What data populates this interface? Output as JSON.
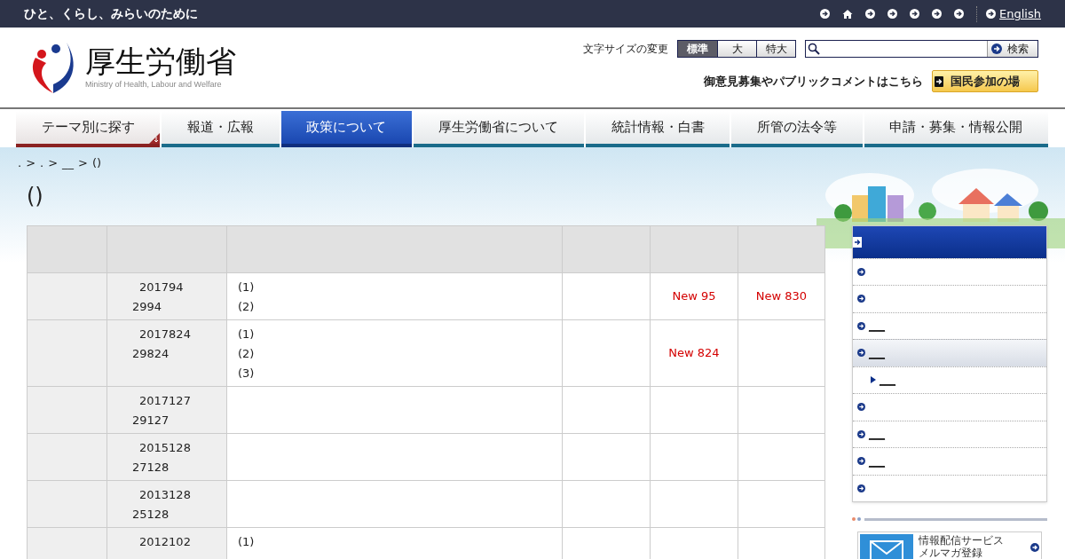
{
  "top_bar": {
    "tagline": "ひと、くらし、みらいのために",
    "links": [
      {
        "kind": "arrow"
      },
      {
        "kind": "home"
      },
      {
        "kind": "arrow"
      },
      {
        "kind": "arrow"
      },
      {
        "kind": "arrow"
      },
      {
        "kind": "arrow"
      },
      {
        "kind": "arrow"
      }
    ],
    "language_link": "English"
  },
  "header": {
    "logo_title": "厚生労働省",
    "logo_subtitle": "Ministry of Health, Labour and Welfare",
    "font_size_label": "文字サイズの変更",
    "font_sizes": [
      {
        "label": "標準",
        "selected": true
      },
      {
        "label": "大",
        "selected": false
      },
      {
        "label": "特大",
        "selected": false
      }
    ],
    "search_button": "検索",
    "comment_text": "御意見募集やパブリックコメントはこちら",
    "participation_button": "国民参加の場"
  },
  "nav": [
    {
      "label": "テーマ別に探す",
      "selected": false,
      "kind": "theme"
    },
    {
      "label": "報道・広報",
      "selected": false,
      "kind": "plain"
    },
    {
      "label": "政策について",
      "selected": true,
      "kind": "plain"
    },
    {
      "label": "厚生労働省について",
      "selected": false,
      "kind": "plain"
    },
    {
      "label": "統計情報・白書",
      "selected": false,
      "kind": "plain"
    },
    {
      "label": "所管の法令等",
      "selected": false,
      "kind": "plain"
    },
    {
      "label": "申請・募集・情報公開",
      "selected": false,
      "kind": "plain"
    }
  ],
  "breadcrumb": [
    ".",
    ">",
    ".",
    ">",
    "__",
    ">",
    "()"
  ],
  "page_title": "()",
  "table": {
    "rows": [
      {
        "date": [
          "201794",
          "2994"
        ],
        "items": [
          "(1)",
          "(2)"
        ],
        "column_5": "New 95",
        "column_6": "New 830"
      },
      {
        "date": [
          "2017824",
          "29824"
        ],
        "items": [
          "(1)",
          "(2)",
          "(3)"
        ],
        "column_5": "New 824"
      },
      {
        "date": [
          "2017127",
          "29127"
        ],
        "items": []
      },
      {
        "date": [
          "2015128",
          "27128"
        ],
        "items": []
      },
      {
        "date": [
          "2013128",
          "25128"
        ],
        "items": []
      },
      {
        "date": [
          "2012102"
        ],
        "items": [
          "(1)"
        ]
      }
    ]
  },
  "sidebar": {
    "items": [
      {
        "selected": false
      },
      {
        "selected": false
      },
      {
        "label": "___",
        "selected": false
      },
      {
        "label": "___",
        "selected": true,
        "children": [
          {
            "label": "___"
          }
        ]
      },
      {
        "selected": false
      },
      {
        "label": "___",
        "selected": false
      },
      {
        "label": "___",
        "selected": false
      },
      {
        "selected": false
      }
    ],
    "banner": {
      "title": "情報配信サービス",
      "subtitle": "メルマガ登録"
    }
  }
}
